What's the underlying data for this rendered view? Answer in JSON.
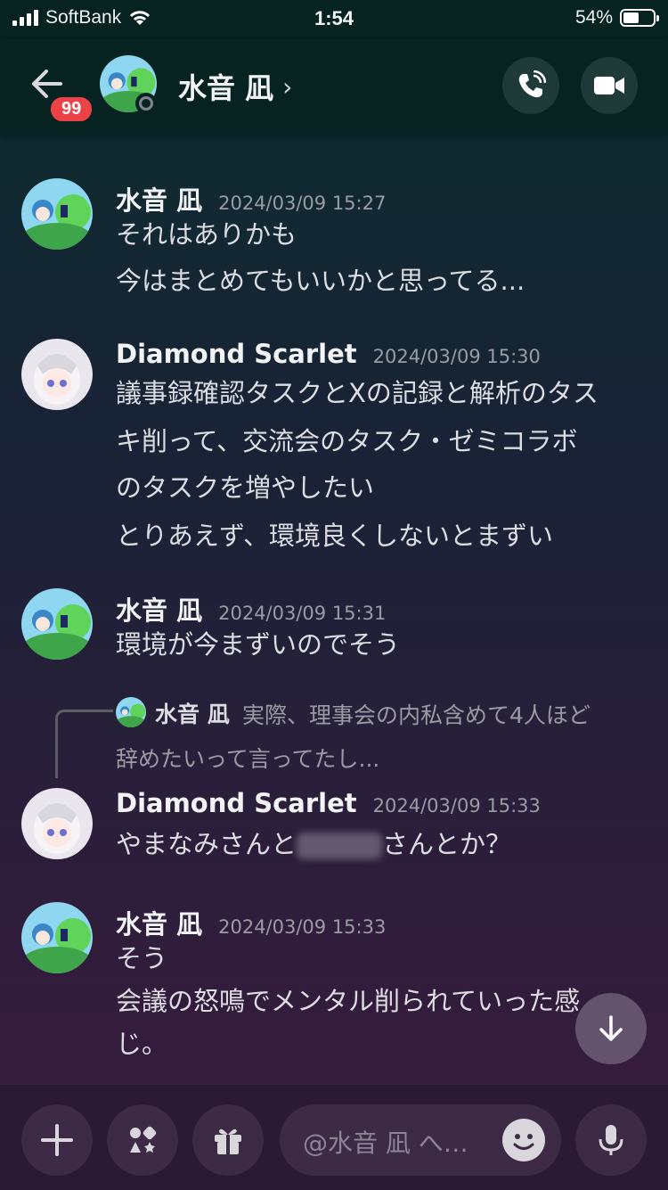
{
  "status_bar": {
    "carrier": "SoftBank",
    "time": "1:54",
    "battery": "54%",
    "battery_level": 0.54
  },
  "header": {
    "title": "水音 凪",
    "unread_badge": "99",
    "call_icon": "phone-call-icon",
    "video_icon": "video-camera-icon"
  },
  "messages": [
    {
      "author": "水音 凪",
      "timestamp": "2024/03/09 15:27",
      "lines": [
        "それはありかも",
        "今はまとめてもいいかと思ってる..."
      ]
    },
    {
      "author": "Diamond Scarlet",
      "timestamp": "2024/03/09 15:30",
      "lines": [
        "議事録確認タスクとXの記録と解析のタス",
        "キ削って、交流会のタスク・ゼミコラボ",
        "のタスクを増やしたい",
        "とりあえず、環境良くしないとまずい"
      ]
    },
    {
      "author": "水音 凪",
      "timestamp": "2024/03/09 15:31",
      "lines": [
        "環境が今まずいのでそう"
      ]
    },
    {
      "author": "Diamond Scarlet",
      "timestamp": "2024/03/09 15:33",
      "line_before_blur": "やまなみさんと",
      "line_after_blur": "さんとか？",
      "reply_to": {
        "author": "水音 凪",
        "text_line1": "実際、理事会の内私含めて4人ほど",
        "text_line2": "辞めたいって言ってたし..."
      }
    },
    {
      "author": "水音 凪",
      "timestamp": "2024/03/09 15:33",
      "lines": [
        "そう",
        "会議の怒鳴でメンタル削られていった感",
        "じ。"
      ]
    }
  ],
  "composer": {
    "placeholder": "@水音 凪 へ…",
    "icons": [
      "plus-icon",
      "apps-icon",
      "gift-icon",
      "emoji-icon",
      "microphone-icon"
    ]
  },
  "colors": {
    "header_bg": "#062321",
    "badge": "#ed4245",
    "accent_text": "#f2f3f5"
  }
}
